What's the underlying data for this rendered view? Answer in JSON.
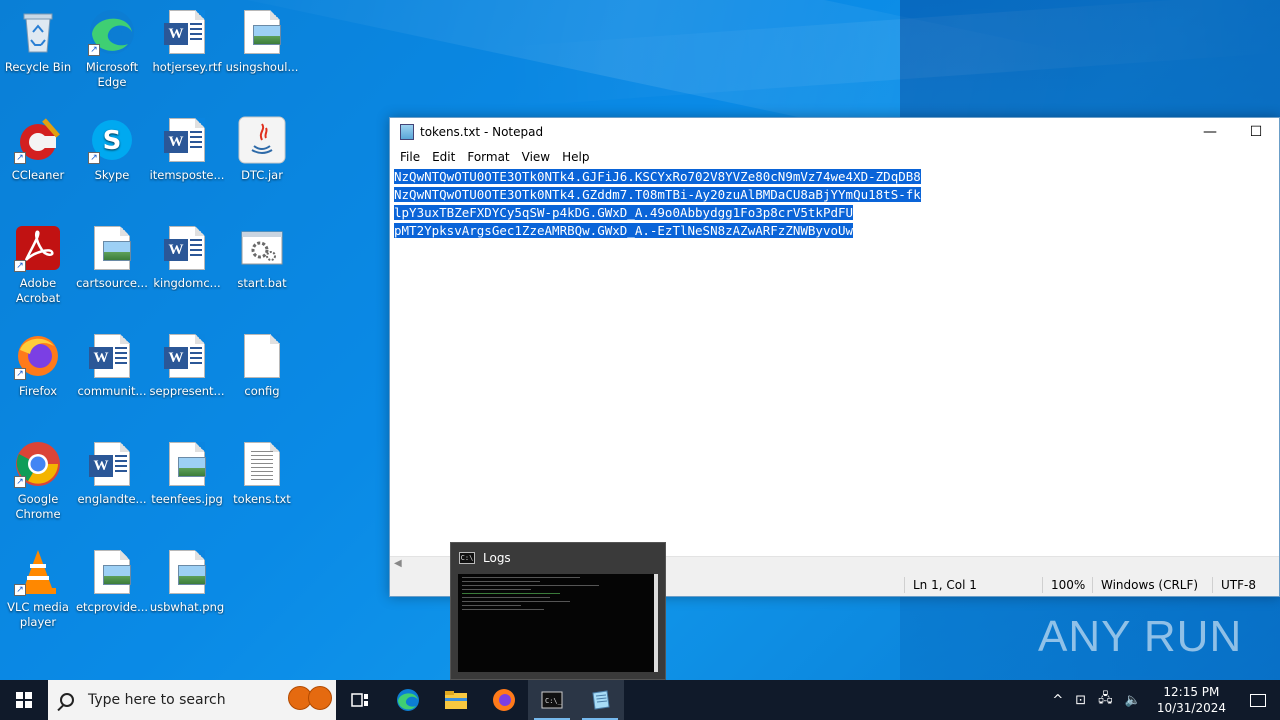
{
  "desktop": {
    "icons": [
      {
        "label": "Recycle Bin",
        "icon": "recycle-bin-icon"
      },
      {
        "label": "Microsoft Edge",
        "icon": "edge-icon"
      },
      {
        "label": "hotjersey.rtf",
        "icon": "word-document-icon"
      },
      {
        "label": "usingshoul...",
        "icon": "image-file-icon"
      },
      {
        "label": "CCleaner",
        "icon": "ccleaner-icon"
      },
      {
        "label": "Skype",
        "icon": "skype-icon"
      },
      {
        "label": "itemsposte...",
        "icon": "word-document-icon"
      },
      {
        "label": "DTC.jar",
        "icon": "java-icon"
      },
      {
        "label": "Adobe Acrobat",
        "icon": "acrobat-icon"
      },
      {
        "label": "cartsource...",
        "icon": "image-file-icon"
      },
      {
        "label": "kingdomc...",
        "icon": "word-document-icon"
      },
      {
        "label": "start.bat",
        "icon": "batch-file-icon"
      },
      {
        "label": "Firefox",
        "icon": "firefox-icon"
      },
      {
        "label": "communit...",
        "icon": "word-document-icon"
      },
      {
        "label": "seppresent...",
        "icon": "word-document-icon"
      },
      {
        "label": "config",
        "icon": "blank-file-icon"
      },
      {
        "label": "Google Chrome",
        "icon": "chrome-icon"
      },
      {
        "label": "englandte...",
        "icon": "word-document-icon"
      },
      {
        "label": "teenfees.jpg",
        "icon": "image-file-icon"
      },
      {
        "label": "tokens.txt",
        "icon": "text-file-icon"
      },
      {
        "label": "VLC media player",
        "icon": "vlc-icon"
      },
      {
        "label": "etcprovide...",
        "icon": "image-file-icon"
      },
      {
        "label": "usbwhat.png",
        "icon": "image-file-icon"
      }
    ]
  },
  "notepad": {
    "title": "tokens.txt - Notepad",
    "menu": [
      "File",
      "Edit",
      "Format",
      "View",
      "Help"
    ],
    "lines": [
      "NzQwNTQwOTU0OTE3OTk0NTk4.GJFiJ6.KSCYxRo702V8YVZe80cN9mVz74we4XD-ZDqDB8",
      "NzQwNTQwOTU0OTE3OTk0NTk4.GZddm7.T08mTBi-Ay20zuAlBMDaCU8aBjYYmQu18tS-fk",
      "lpY3uxTBZeFXDYCy5qSW-p4kDG.GWxD_A.49o0Abbydgg1Fo3p8crV5tkPdFU",
      "pMT2YpksvArgsGec1ZzeAMRBQw.GWxD_A.-EzTlNeSN8zAZwARFzZNWByvoUw"
    ],
    "status": {
      "position": "Ln 1, Col 1",
      "zoom": "100%",
      "line_ending": "Windows (CRLF)",
      "encoding": "UTF-8"
    }
  },
  "logs_window": {
    "title": "Logs"
  },
  "watermark": "ANY RUN",
  "taskbar": {
    "search_placeholder": "Type here to search",
    "time": "12:15 PM",
    "date": "10/31/2024"
  }
}
